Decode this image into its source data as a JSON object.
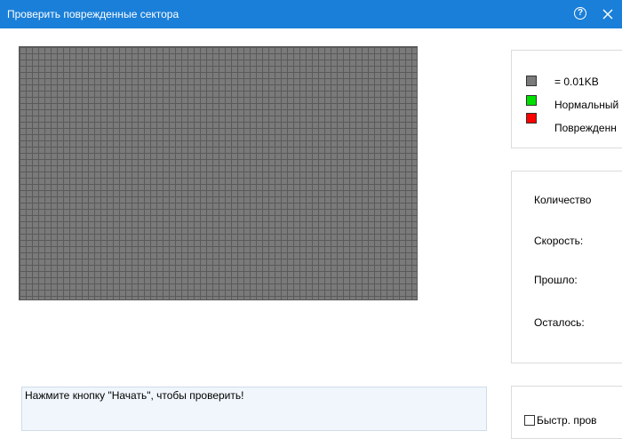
{
  "window": {
    "title": "Проверить поврежденные сектора",
    "help_icon": "question-circle-icon",
    "close_icon": "close-icon",
    "accent_color": "#1a7fd8"
  },
  "legend": {
    "items": [
      {
        "label": "= 0.01KB",
        "color": "#7a7a7a"
      },
      {
        "label": "Нормальный",
        "color": "#00e000"
      },
      {
        "label": "Поврежденн",
        "color": "#ff0000"
      }
    ]
  },
  "stats": {
    "count_label": "Количество",
    "speed_label": "Скорость:",
    "elapsed_label": "Прошло:",
    "remaining_label": "Осталось:"
  },
  "status": {
    "message": "Нажмите кнопку \"Начать\", чтобы проверить!"
  },
  "options": {
    "quick_check_label": "Быстр. пров",
    "quick_check_checked": false
  }
}
